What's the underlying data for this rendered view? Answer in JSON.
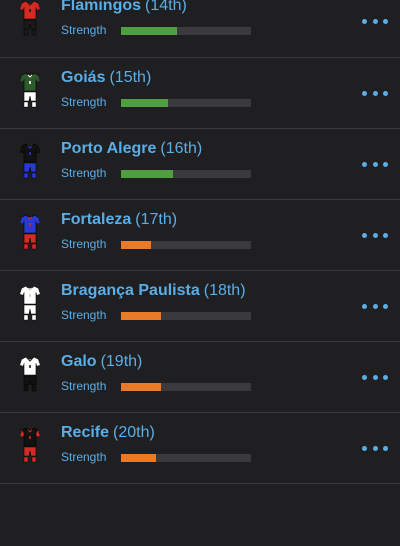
{
  "strength_label": "Strength",
  "teams": [
    {
      "name": "Flamingos",
      "position": "(14th)",
      "strength": 0.43,
      "bar_color": "#4f9e40",
      "kit": {
        "shirt": "#d42a24",
        "trim": "#1a1a1a",
        "shorts": "#1a1a1a",
        "sleeves": "#d42a24"
      }
    },
    {
      "name": "Goiás",
      "position": "(15th)",
      "strength": 0.36,
      "bar_color": "#4f9e40",
      "kit": {
        "shirt": "#2d5a2d",
        "trim": "#ffffff",
        "shorts": "#ffffff",
        "sleeves": "#2d5a2d"
      }
    },
    {
      "name": "Porto Alegre",
      "position": "(16th)",
      "strength": 0.4,
      "bar_color": "#4f9e40",
      "kit": {
        "shirt": "#111111",
        "trim": "#2a3ad0",
        "shorts": "#2a3ad0",
        "sleeves": "#111111"
      }
    },
    {
      "name": "Fortaleza",
      "position": "(17th)",
      "strength": 0.23,
      "bar_color": "#e87a28",
      "kit": {
        "shirt": "#2a3ad0",
        "trim": "#d42a24",
        "shorts": "#d42a24",
        "sleeves": "#2a3ad0"
      }
    },
    {
      "name": "Bragança Paulista",
      "position": "(18th)",
      "strength": 0.31,
      "bar_color": "#e87a28",
      "kit": {
        "shirt": "#ffffff",
        "trim": "#cccccc",
        "shorts": "#ffffff",
        "sleeves": "#ffffff"
      }
    },
    {
      "name": "Galo",
      "position": "(19th)",
      "strength": 0.31,
      "bar_color": "#e87a28",
      "kit": {
        "shirt": "#ffffff",
        "trim": "#222222",
        "shorts": "#111111",
        "sleeves": "#ffffff"
      }
    },
    {
      "name": "Recife",
      "position": "(20th)",
      "strength": 0.27,
      "bar_color": "#e87a28",
      "kit": {
        "shirt": "#111111",
        "trim": "#d42a24",
        "shorts": "#d42a24",
        "sleeves": "#d42a24"
      }
    }
  ]
}
